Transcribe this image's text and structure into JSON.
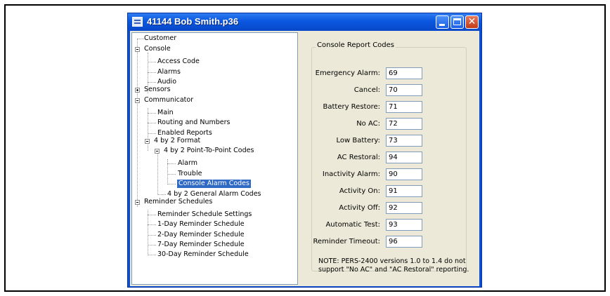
{
  "window": {
    "title": "41144 Bob Smith.p36"
  },
  "tree": {
    "customer": "Customer",
    "console": "Console",
    "access_code": "Access Code",
    "alarms": "Alarms",
    "audio": "Audio",
    "sensors": "Sensors",
    "communicator": "Communicator",
    "main": "Main",
    "routing": "Routing and Numbers",
    "enabled_reports": "Enabled Reports",
    "format_4by2": "4 by 2 Format",
    "p2p_codes": "4 by 2 Point-To-Point Codes",
    "alarm": "Alarm",
    "trouble": "Trouble",
    "console_alarm_codes": "Console Alarm Codes",
    "general_alarm_codes": "4 by 2 General Alarm Codes",
    "reminder_schedules": "Reminder Schedules",
    "reminder_settings": "Reminder Schedule Settings",
    "day1": "1-Day Reminder Schedule",
    "day2": "2-Day Reminder Schedule",
    "day7": "7-Day Reminder Schedule",
    "day30": "30-Day Reminder Schedule"
  },
  "panel": {
    "group_title": "Console Report Codes",
    "fields": [
      {
        "label": "Emergency Alarm:",
        "value": "69"
      },
      {
        "label": "Cancel:",
        "value": "70"
      },
      {
        "label": "Battery Restore:",
        "value": "71"
      },
      {
        "label": "No AC:",
        "value": "72"
      },
      {
        "label": "Low Battery:",
        "value": "73"
      },
      {
        "label": "AC Restoral:",
        "value": "94"
      },
      {
        "label": "Inactivity Alarm:",
        "value": "90"
      },
      {
        "label": "Activity On:",
        "value": "91"
      },
      {
        "label": "Activity Off:",
        "value": "92"
      },
      {
        "label": "Automatic Test:",
        "value": "93"
      },
      {
        "label": "Reminder Timeout:",
        "value": "96"
      }
    ],
    "note": "NOTE: PERS-2400 versions 1.0 to 1.4 do not support \"No AC\" and \"AC Restoral\" reporting."
  },
  "colors": {
    "titlebar": "#0a57e0",
    "selection": "#316ac5",
    "close_button": "#c13a16"
  }
}
